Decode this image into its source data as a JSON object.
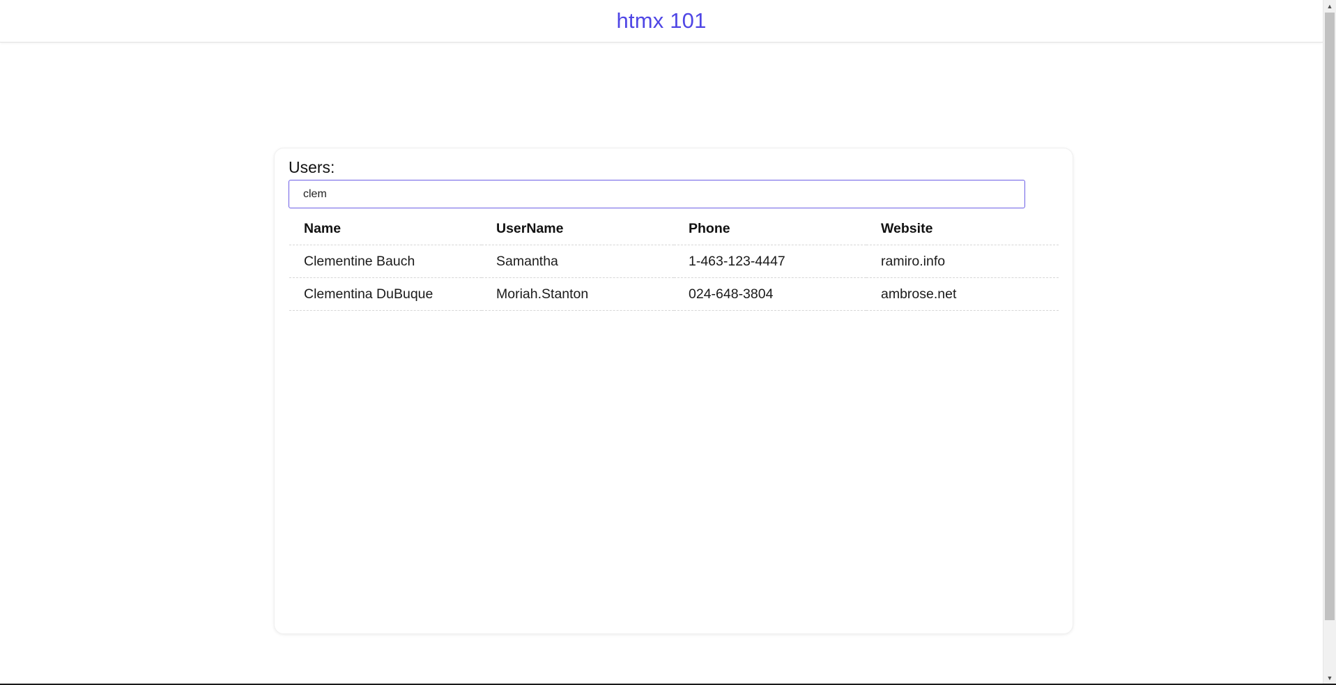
{
  "header": {
    "title": "htmx 101",
    "accent_color": "#4f46e5"
  },
  "users_card": {
    "heading": "Users:",
    "search": {
      "value": "clem"
    },
    "table": {
      "columns": [
        "Name",
        "UserName",
        "Phone",
        "Website"
      ],
      "rows": [
        [
          "Clementine Bauch",
          "Samantha",
          "1-463-123-4447",
          "ramiro.info"
        ],
        [
          "Clementina DuBuque",
          "Moriah.Stanton",
          "024-648-3804",
          "ambrose.net"
        ]
      ]
    }
  },
  "scrollbar": {
    "up_icon": "chevron-up-icon",
    "down_icon": "chevron-down-icon"
  }
}
